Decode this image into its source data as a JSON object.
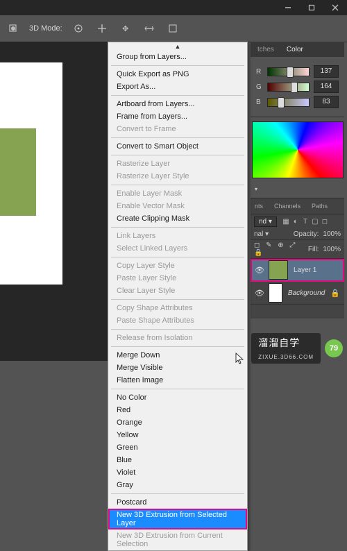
{
  "titlebar": {},
  "optbar": {
    "mode_label": "3D Mode:"
  },
  "ctxmenu": {
    "items": [
      {
        "label": "Group from Layers...",
        "state": "normal"
      },
      {
        "sep": true
      },
      {
        "label": "Quick Export as PNG",
        "state": "normal"
      },
      {
        "label": "Export As...",
        "state": "normal"
      },
      {
        "sep": true
      },
      {
        "label": "Artboard from Layers...",
        "state": "normal"
      },
      {
        "label": "Frame from Layers...",
        "state": "normal"
      },
      {
        "label": "Convert to Frame",
        "state": "disabled"
      },
      {
        "sep": true
      },
      {
        "label": "Convert to Smart Object",
        "state": "normal"
      },
      {
        "sep": true
      },
      {
        "label": "Rasterize Layer",
        "state": "disabled"
      },
      {
        "label": "Rasterize Layer Style",
        "state": "disabled"
      },
      {
        "sep": true
      },
      {
        "label": "Enable Layer Mask",
        "state": "disabled"
      },
      {
        "label": "Enable Vector Mask",
        "state": "disabled"
      },
      {
        "label": "Create Clipping Mask",
        "state": "normal"
      },
      {
        "sep": true
      },
      {
        "label": "Link Layers",
        "state": "disabled"
      },
      {
        "label": "Select Linked Layers",
        "state": "disabled"
      },
      {
        "sep": true
      },
      {
        "label": "Copy Layer Style",
        "state": "disabled"
      },
      {
        "label": "Paste Layer Style",
        "state": "disabled"
      },
      {
        "label": "Clear Layer Style",
        "state": "disabled"
      },
      {
        "sep": true
      },
      {
        "label": "Copy Shape Attributes",
        "state": "disabled"
      },
      {
        "label": "Paste Shape Attributes",
        "state": "disabled"
      },
      {
        "sep": true
      },
      {
        "label": "Release from Isolation",
        "state": "disabled"
      },
      {
        "sep": true
      },
      {
        "label": "Merge Down",
        "state": "normal"
      },
      {
        "label": "Merge Visible",
        "state": "normal"
      },
      {
        "label": "Flatten Image",
        "state": "normal"
      },
      {
        "sep": true
      },
      {
        "label": "No Color",
        "state": "normal"
      },
      {
        "label": "Red",
        "state": "normal"
      },
      {
        "label": "Orange",
        "state": "normal"
      },
      {
        "label": "Yellow",
        "state": "normal"
      },
      {
        "label": "Green",
        "state": "normal"
      },
      {
        "label": "Blue",
        "state": "normal"
      },
      {
        "label": "Violet",
        "state": "normal"
      },
      {
        "label": "Gray",
        "state": "normal"
      },
      {
        "sep": true
      },
      {
        "label": "Postcard",
        "state": "normal"
      },
      {
        "label": "New 3D Extrusion from Selected Layer",
        "state": "highlight-boxed"
      },
      {
        "label": "New 3D Extrusion from Current Selection",
        "state": "disabled"
      }
    ]
  },
  "panels": {
    "tabs_top": {
      "left": "tches",
      "right": "Color"
    },
    "color": {
      "sliders": [
        {
          "label": "R",
          "value": "137",
          "pct": 54,
          "grad": "linear-gradient(to right,#003400,#ffd4d4)"
        },
        {
          "label": "G",
          "value": "164",
          "pct": 64,
          "grad": "linear-gradient(to right,#500000,#d0ffd0)"
        },
        {
          "label": "B",
          "value": "83",
          "pct": 33,
          "grad": "linear-gradient(to right,#5a5a00,#c8c8ff)"
        }
      ]
    },
    "mini_tabs": [
      "nts",
      "Channels",
      "Paths"
    ],
    "layers": {
      "blend_sel": "nd",
      "blend2": "nal",
      "opacity_label": "Opacity:",
      "opacity_val": "100%",
      "fill_label": "Fill:",
      "fill_val": "100%",
      "rows": [
        {
          "name": "Layer 1",
          "thumb": "#86a351",
          "selected": true,
          "locked": false
        },
        {
          "name": "Background",
          "thumb": "#ffffff",
          "selected": false,
          "locked": true
        }
      ]
    }
  },
  "watermark": {
    "brand": "溜溜自学",
    "site": "ZIXUE.3D66.COM",
    "badge": "79"
  }
}
